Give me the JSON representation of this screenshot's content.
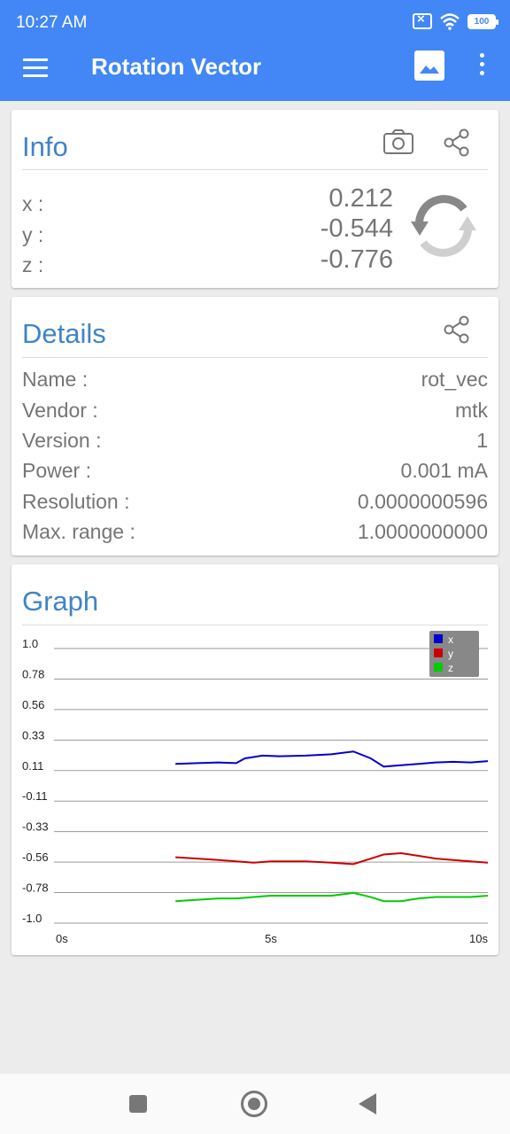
{
  "status": {
    "time": "10:27 AM",
    "battery": "100"
  },
  "app": {
    "title": "Rotation Vector"
  },
  "info": {
    "title": "Info",
    "x_label": "x :",
    "x_value": "0.212",
    "y_label": "y :",
    "y_value": "-0.544",
    "z_label": "z :",
    "z_value": "-0.776"
  },
  "details": {
    "title": "Details",
    "rows": [
      {
        "label": "Name :",
        "value": "rot_vec"
      },
      {
        "label": "Vendor :",
        "value": "mtk"
      },
      {
        "label": "Version :",
        "value": "1"
      },
      {
        "label": "Power :",
        "value": "0.001 mA"
      },
      {
        "label": "Resolution :",
        "value": "0.0000000596"
      },
      {
        "label": "Max. range :",
        "value": "1.0000000000"
      }
    ]
  },
  "graph": {
    "title": "Graph"
  },
  "chart_data": {
    "type": "line",
    "ylim": [
      -1.0,
      1.0
    ],
    "y_ticks": [
      "1.0",
      "0.78",
      "0.56",
      "0.33",
      "0.11",
      "-0.11",
      "-0.33",
      "-0.56",
      "-0.78",
      "-1.0"
    ],
    "x_ticks": [
      "0s",
      "5s",
      "10s"
    ],
    "xlim": [
      0,
      10
    ],
    "legend_position": "top-right",
    "grid": true,
    "series": [
      {
        "name": "x",
        "color": "#0000cc",
        "x": [
          2.8,
          3.3,
          3.8,
          4.2,
          4.4,
          4.6,
          4.8,
          5.2,
          5.8,
          6.4,
          6.9,
          7.3,
          7.6,
          8.0,
          8.4,
          8.8,
          9.2,
          9.6,
          10.0
        ],
        "y": [
          0.16,
          0.165,
          0.17,
          0.165,
          0.2,
          0.21,
          0.22,
          0.215,
          0.22,
          0.23,
          0.25,
          0.2,
          0.14,
          0.15,
          0.16,
          0.17,
          0.175,
          0.17,
          0.18
        ]
      },
      {
        "name": "y",
        "color": "#cc0000",
        "x": [
          2.8,
          3.3,
          3.8,
          4.2,
          4.6,
          5.0,
          5.4,
          5.8,
          6.4,
          6.9,
          7.3,
          7.6,
          8.0,
          8.4,
          8.8,
          9.2,
          9.6,
          10.0
        ],
        "y": [
          -0.52,
          -0.53,
          -0.54,
          -0.55,
          -0.56,
          -0.55,
          -0.55,
          -0.55,
          -0.56,
          -0.57,
          -0.53,
          -0.5,
          -0.49,
          -0.51,
          -0.53,
          -0.54,
          -0.55,
          -0.56
        ]
      },
      {
        "name": "z",
        "color": "#00cc00",
        "x": [
          2.8,
          3.3,
          3.8,
          4.2,
          4.6,
          5.0,
          5.4,
          5.8,
          6.4,
          6.9,
          7.3,
          7.6,
          8.0,
          8.4,
          8.8,
          9.2,
          9.6,
          10.0
        ],
        "y": [
          -0.84,
          -0.83,
          -0.82,
          -0.82,
          -0.81,
          -0.8,
          -0.8,
          -0.8,
          -0.8,
          -0.78,
          -0.81,
          -0.84,
          -0.84,
          -0.82,
          -0.81,
          -0.81,
          -0.81,
          -0.8
        ]
      }
    ]
  }
}
